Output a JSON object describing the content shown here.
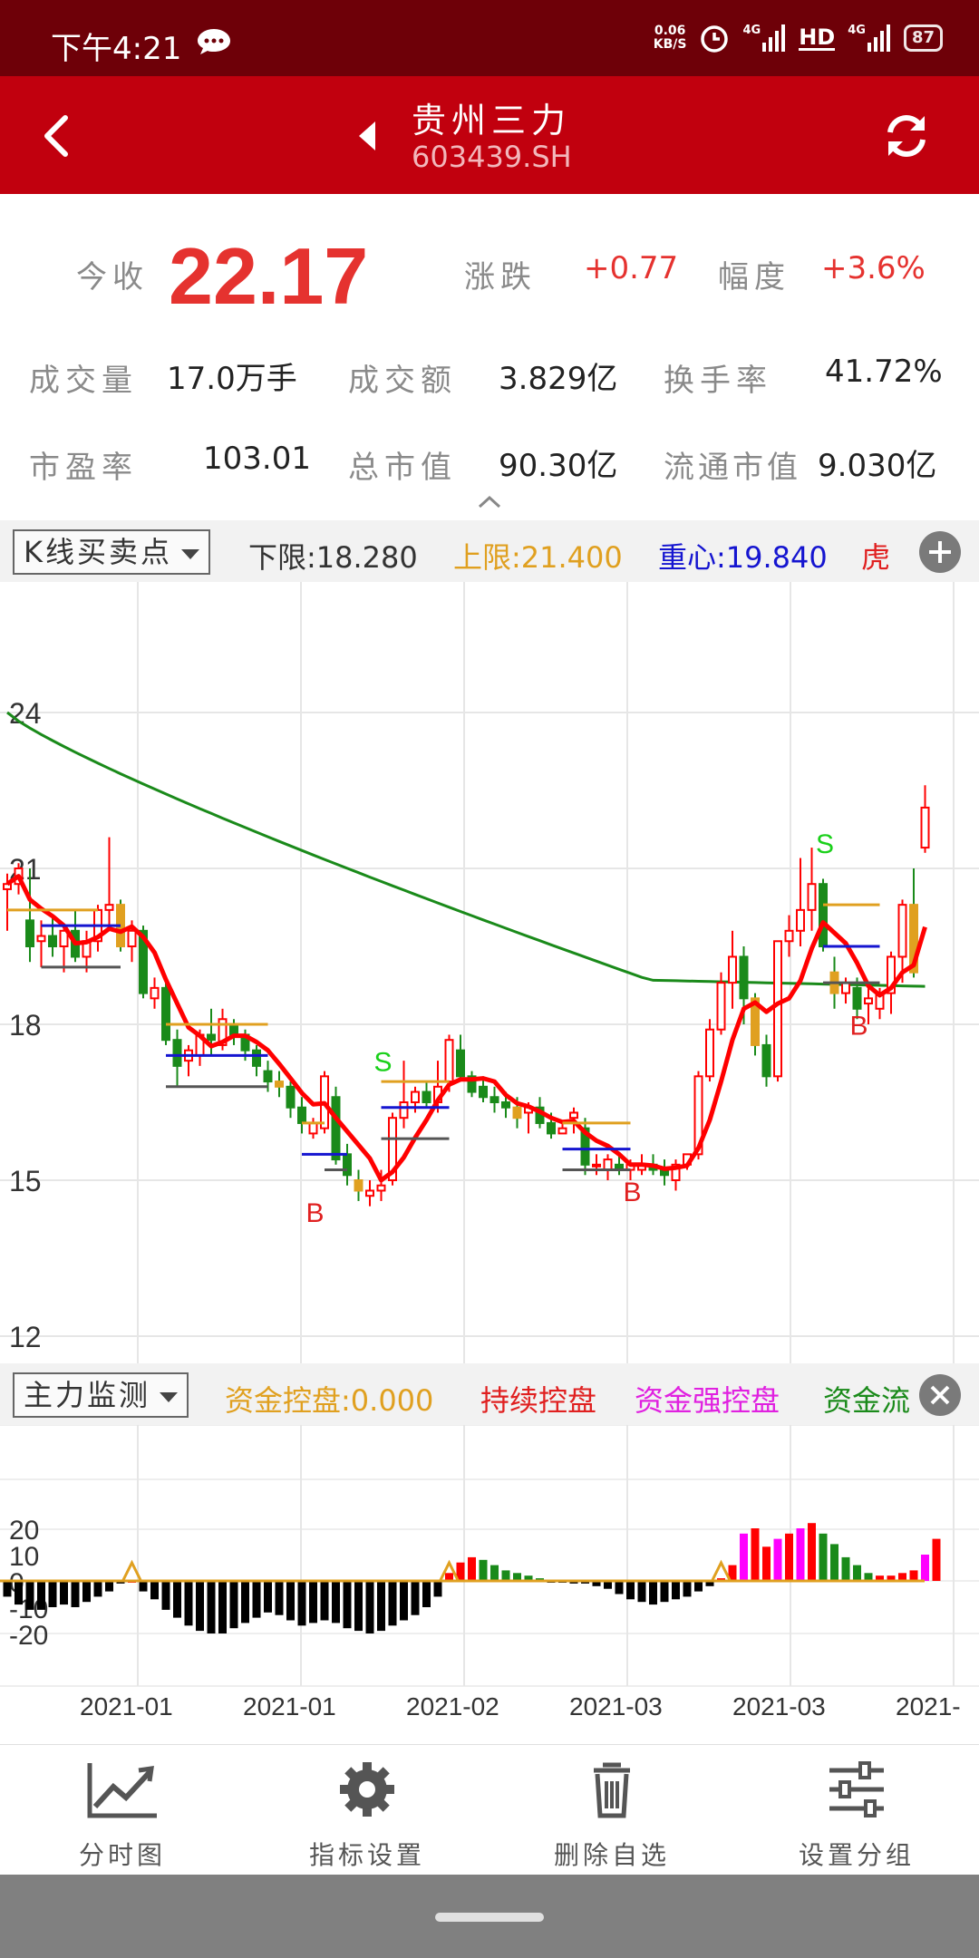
{
  "status_bar": {
    "time": "下午4:21",
    "net_speed_value": "0.06",
    "net_speed_unit": "KB/S",
    "signal_1": "4G",
    "hd": "HD",
    "signal_2": "4G",
    "battery": "87",
    "icons": [
      "chat-bubble-icon",
      "alarm-icon",
      "signal-icon",
      "hd-icon",
      "signal-icon",
      "battery-icon"
    ]
  },
  "header": {
    "stock_name": "贵州三力",
    "stock_code": "603439.SH",
    "icons": [
      "back-arrow-icon",
      "prev-stock-icon",
      "refresh-icon"
    ]
  },
  "quote": {
    "close_label": "今收",
    "close_value": "22.17",
    "change_label": "涨跌",
    "change_value": "+0.77",
    "amplitude_label": "幅度",
    "amplitude_value": "+3.6%",
    "volume_label": "成交量",
    "volume_value": "17.0万手",
    "turnover_label": "成交额",
    "turnover_value": "3.829亿",
    "turnover_rate_label": "换手率",
    "turnover_rate_value": "41.72%",
    "pe_label": "市盈率",
    "pe_value": "103.01",
    "market_cap_label": "总市值",
    "market_cap_value": "90.30亿",
    "float_cap_label": "流通市值",
    "float_cap_value": "9.030亿"
  },
  "indicator_bar": {
    "selected": "K线买卖点",
    "lower_limit": "下限:18.280",
    "upper_limit": "上限:21.400",
    "center": "重心:19.840",
    "tiger": "虎",
    "colors": {
      "lower": "#333333",
      "upper": "#e0a020",
      "center": "#1515d0",
      "tiger": "#e02020"
    }
  },
  "sub_indicator_bar": {
    "selected": "主力监测",
    "fund_control": "资金控盘:0.000",
    "continuous": "持续控盘",
    "strong": "资金强控盘",
    "truncated": "资金流",
    "colors": {
      "fund_control": "#e0a020",
      "continuous": "#e02020",
      "strong": "#e020e0",
      "truncated": "#1a8a1a"
    }
  },
  "chart_data": [
    {
      "type": "candlestick",
      "y_ticks": [
        "24",
        "21",
        "18",
        "15",
        "12"
      ],
      "ylim": [
        12,
        24.5
      ],
      "signals": [
        "S",
        "B",
        "S",
        "B",
        "S",
        "B"
      ],
      "series": [
        {
          "name": "",
          "color": "#ff0000",
          "role": "moving-average-short"
        },
        {
          "name": "",
          "color": "#1a8a1a",
          "role": "moving-average-long"
        }
      ],
      "last_close": 22.17,
      "candles": [
        [
          20.6,
          20.9,
          19.8,
          20.7
        ],
        [
          20.7,
          21.1,
          20.5,
          21.0
        ],
        [
          20.0,
          21.0,
          19.2,
          19.5
        ],
        [
          19.6,
          20.0,
          19.1,
          19.7
        ],
        [
          19.7,
          20.1,
          19.3,
          19.5
        ],
        [
          19.5,
          19.9,
          19.0,
          19.8
        ],
        [
          19.8,
          20.2,
          19.2,
          19.3
        ],
        [
          19.3,
          19.8,
          19.0,
          19.6
        ],
        [
          19.6,
          20.3,
          19.4,
          20.2
        ],
        [
          20.2,
          21.6,
          19.8,
          20.3
        ],
        [
          20.3,
          20.4,
          19.4,
          19.5
        ],
        [
          19.5,
          20.0,
          19.2,
          19.8
        ],
        [
          19.8,
          19.9,
          18.5,
          18.6
        ],
        [
          18.5,
          18.9,
          18.3,
          18.7
        ],
        [
          18.7,
          18.8,
          17.6,
          17.7
        ],
        [
          17.7,
          17.9,
          16.8,
          17.2
        ],
        [
          17.3,
          17.6,
          17.0,
          17.5
        ],
        [
          17.4,
          17.9,
          17.2,
          17.8
        ],
        [
          17.8,
          18.3,
          17.4,
          17.7
        ],
        [
          17.6,
          18.3,
          17.5,
          18.1
        ],
        [
          18.0,
          18.1,
          17.6,
          17.8
        ],
        [
          17.8,
          17.9,
          17.3,
          17.5
        ],
        [
          17.5,
          17.6,
          17.0,
          17.2
        ],
        [
          17.1,
          17.3,
          16.7,
          16.9
        ],
        [
          16.9,
          17.1,
          16.6,
          16.8
        ],
        [
          16.8,
          16.9,
          16.2,
          16.4
        ],
        [
          16.4,
          16.6,
          15.9,
          16.1
        ],
        [
          15.9,
          16.2,
          15.8,
          16.1
        ],
        [
          16.0,
          17.1,
          15.9,
          17.0
        ],
        [
          16.6,
          16.8,
          15.3,
          15.4
        ],
        [
          15.5,
          15.7,
          14.9,
          15.1
        ],
        [
          15.0,
          15.2,
          14.6,
          14.8
        ],
        [
          14.7,
          15.0,
          14.5,
          14.8
        ],
        [
          14.8,
          15.2,
          14.6,
          14.9
        ],
        [
          15.0,
          16.3,
          14.9,
          16.2
        ],
        [
          16.2,
          17.3,
          16.0,
          16.5
        ],
        [
          16.5,
          16.8,
          16.3,
          16.7
        ],
        [
          16.7,
          16.9,
          16.4,
          16.5
        ],
        [
          16.5,
          17.3,
          16.3,
          16.8
        ],
        [
          16.9,
          17.8,
          16.7,
          17.7
        ],
        [
          17.5,
          17.8,
          16.9,
          17.0
        ],
        [
          17.0,
          17.1,
          16.6,
          16.7
        ],
        [
          16.8,
          17.0,
          16.5,
          16.6
        ],
        [
          16.6,
          16.8,
          16.3,
          16.5
        ],
        [
          16.5,
          16.7,
          16.2,
          16.4
        ],
        [
          16.4,
          16.6,
          16.0,
          16.2
        ],
        [
          16.3,
          16.5,
          15.9,
          16.4
        ],
        [
          16.4,
          16.6,
          16.0,
          16.1
        ],
        [
          16.1,
          16.3,
          15.8,
          15.9
        ],
        [
          15.9,
          16.1,
          15.9,
          16.0
        ],
        [
          16.2,
          16.4,
          15.9,
          16.3
        ],
        [
          16.0,
          16.2,
          15.1,
          15.3
        ],
        [
          15.3,
          15.5,
          15.1,
          15.3
        ],
        [
          15.2,
          15.5,
          15.0,
          15.4
        ],
        [
          15.3,
          15.5,
          15.1,
          15.2
        ],
        [
          15.2,
          15.4,
          15.0,
          15.3
        ],
        [
          15.2,
          15.5,
          15.1,
          15.3
        ],
        [
          15.3,
          15.5,
          15.1,
          15.2
        ],
        [
          15.2,
          15.4,
          14.9,
          15.1
        ],
        [
          15.0,
          15.4,
          14.8,
          15.3
        ],
        [
          15.3,
          15.5,
          15.2,
          15.5
        ],
        [
          15.5,
          17.1,
          15.4,
          17.0
        ],
        [
          17.0,
          18.1,
          16.9,
          17.9
        ],
        [
          17.9,
          19.0,
          17.8,
          18.8
        ],
        [
          18.8,
          19.8,
          18.3,
          19.3
        ],
        [
          19.3,
          19.5,
          18.0,
          18.5
        ],
        [
          18.5,
          18.6,
          17.4,
          17.6
        ],
        [
          17.6,
          17.8,
          16.8,
          17.0
        ],
        [
          17.0,
          19.6,
          16.9,
          19.6
        ],
        [
          19.6,
          20.1,
          19.3,
          19.8
        ],
        [
          19.8,
          21.2,
          19.5,
          20.2
        ],
        [
          20.2,
          21.4,
          19.8,
          20.7
        ],
        [
          20.7,
          20.8,
          19.4,
          19.5
        ],
        [
          19.0,
          19.3,
          18.3,
          18.6
        ],
        [
          18.6,
          18.9,
          18.4,
          18.8
        ],
        [
          18.7,
          18.9,
          18.1,
          18.3
        ],
        [
          18.4,
          18.7,
          18.0,
          18.5
        ],
        [
          18.3,
          18.7,
          18.1,
          18.6
        ],
        [
          18.6,
          19.4,
          18.2,
          19.3
        ],
        [
          19.3,
          20.4,
          18.8,
          20.3
        ],
        [
          20.3,
          21.0,
          18.9,
          19.0
        ],
        [
          21.4,
          22.6,
          21.3,
          22.17
        ]
      ]
    },
    {
      "type": "bar",
      "x_ticks": [
        "2021-01",
        "2021-01",
        "2021-02",
        "2021-03",
        "2021-03",
        "2021-"
      ],
      "y_ticks": [
        "20",
        "10",
        "0",
        "-10",
        "-20"
      ],
      "ylim": [
        -24,
        26
      ],
      "colors": {
        "negative": "#000000",
        "red": "#ff0000",
        "green": "#1a8a1a",
        "magenta": "#ff00ff",
        "line": "#e0a020"
      },
      "values": [
        -6,
        -9,
        -11,
        -11,
        -10,
        -9,
        -10,
        -8,
        -6,
        -4,
        -1,
        0,
        -4,
        -7,
        -11,
        -14,
        -17,
        -19,
        -20,
        -20,
        -18,
        -16,
        -14,
        -12,
        -13,
        -15,
        -17,
        -16,
        -15,
        -16,
        -18,
        -19,
        -20,
        -19,
        -17,
        -15,
        -13,
        -10,
        -6,
        3,
        7,
        9,
        8,
        6,
        4,
        3,
        2,
        1,
        0,
        0,
        -1,
        -1,
        -2,
        -3,
        -5,
        -7,
        -8,
        -9,
        -8,
        -7,
        -6,
        -4,
        -2,
        1,
        6,
        18,
        20,
        13,
        16,
        18,
        20,
        22,
        18,
        14,
        9,
        6,
        3,
        2,
        2,
        3,
        4,
        10,
        16
      ],
      "bar_color_index": [
        0,
        0,
        0,
        0,
        0,
        0,
        0,
        0,
        0,
        0,
        0,
        1,
        0,
        0,
        0,
        0,
        0,
        0,
        0,
        0,
        0,
        0,
        0,
        0,
        0,
        0,
        0,
        0,
        0,
        0,
        0,
        0,
        0,
        0,
        0,
        0,
        0,
        0,
        0,
        1,
        1,
        1,
        2,
        2,
        2,
        2,
        2,
        2,
        0,
        0,
        0,
        0,
        0,
        0,
        0,
        0,
        0,
        0,
        0,
        0,
        0,
        0,
        0,
        1,
        1,
        3,
        1,
        1,
        3,
        1,
        3,
        1,
        2,
        2,
        2,
        2,
        2,
        1,
        1,
        1,
        1,
        3,
        1
      ]
    }
  ],
  "tab_bar": {
    "tabs": [
      {
        "label": "分时图",
        "icon": "line-chart-icon"
      },
      {
        "label": "指标设置",
        "icon": "gear-icon"
      },
      {
        "label": "删除自选",
        "icon": "trash-icon"
      },
      {
        "label": "设置分组",
        "icon": "sliders-icon"
      }
    ]
  }
}
